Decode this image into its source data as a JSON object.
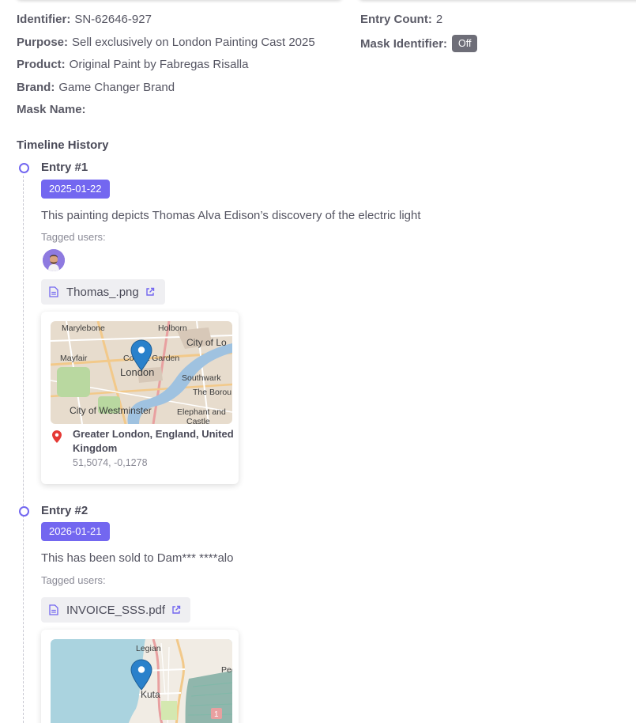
{
  "details": {
    "identifier": {
      "label": "Identifier:",
      "value": "SN-62646-927"
    },
    "purpose": {
      "label": "Purpose:",
      "value": "Sell exclusively on London Painting Cast 2025"
    },
    "product": {
      "label": "Product:",
      "value": "Original Paint by Fabregas Risalla"
    },
    "brand": {
      "label": "Brand:",
      "value": "Game Changer Brand"
    },
    "mask_name": {
      "label": "Mask Name:",
      "value": ""
    },
    "entry_count": {
      "label": "Entry Count:",
      "value": "2"
    },
    "mask_identifier": {
      "label": "Mask Identifier:",
      "value": "Off"
    }
  },
  "timeline": {
    "title": "Timeline History",
    "entries": [
      {
        "title": "Entry #1",
        "date": "2025-01-22",
        "description": "This painting depicts Thomas Alva Edison’s discovery of the electric light",
        "tagged_label": "Tagged users:",
        "file": "Thomas_.png",
        "location": {
          "name": "Greater London, England, United Kingdom",
          "coords": "51,5074, -0,1278",
          "map_labels": [
            "Marylebone",
            "Holborn",
            "Mayfair",
            "Covent Garden",
            "London",
            "City of Lo",
            "Southwark",
            "The Borou",
            "City of Westminster",
            "Elephant and",
            "Castle"
          ]
        }
      },
      {
        "title": "Entry #2",
        "date": "2026-01-21",
        "description": "This has been sold to Dam*** ****alo",
        "tagged_label": "Tagged users:",
        "file": "INVOICE_SSS.pdf",
        "location": {
          "map_labels": [
            "Legian",
            "Kuta",
            "Pec",
            "1"
          ]
        }
      }
    ]
  },
  "colors": {
    "accent": "#7367f0",
    "badge_off": "#6e6e78",
    "pin": "#2a81cb"
  }
}
